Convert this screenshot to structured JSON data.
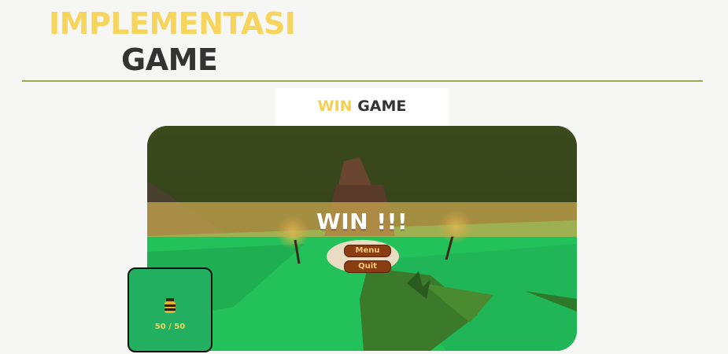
{
  "slide": {
    "title_line1": "IMPLEMENTASI",
    "title_line2": "GAME",
    "caption_accent": "WIN",
    "caption_main": "GAME"
  },
  "game": {
    "win_banner": "WIN !!!",
    "menu_button": "Menu",
    "quit_button": "Quit",
    "hud_counter": "50 / 50",
    "hud_icon": "honey-jar-icon"
  },
  "colors": {
    "accent": "#f7d55c",
    "title_dark": "#333333",
    "rule": "#9aaa52",
    "ground": "#22b060",
    "button": "#8a3d13"
  }
}
